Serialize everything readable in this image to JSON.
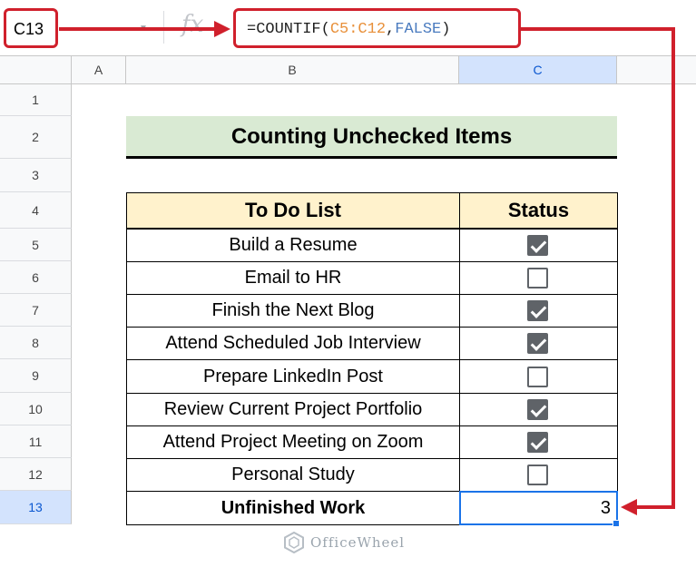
{
  "formula_bar": {
    "name_box": "C13",
    "fx": "fx",
    "formula": {
      "prefix": "=COUNTIF(",
      "range": "C5:C12",
      "comma": ",",
      "arg": "FALSE",
      "suffix": ")"
    }
  },
  "columns": [
    "A",
    "B",
    "C"
  ],
  "rows": [
    "1",
    "2",
    "3",
    "4",
    "5",
    "6",
    "7",
    "8",
    "9",
    "10",
    "11",
    "12",
    "13"
  ],
  "active_cell": {
    "column": "C",
    "row": "13"
  },
  "title": "Counting Unchecked Items",
  "table": {
    "headers": [
      "To Do List",
      "Status"
    ],
    "items": [
      {
        "task": "Build a Resume",
        "checked": true
      },
      {
        "task": "Email to HR",
        "checked": false
      },
      {
        "task": "Finish the Next Blog",
        "checked": true
      },
      {
        "task": "Attend Scheduled Job Interview",
        "checked": true
      },
      {
        "task": "Prepare LinkedIn Post",
        "checked": false
      },
      {
        "task": "Review Current Project Portfolio",
        "checked": true
      },
      {
        "task": "Attend Project Meeting on Zoom",
        "checked": true
      },
      {
        "task": "Personal Study",
        "checked": false
      }
    ],
    "summary": {
      "label": "Unfinished Work",
      "value": "3"
    }
  },
  "watermark": "OfficeWheel",
  "colors": {
    "highlight_red": "#d0202c",
    "title_bg": "#d9ead3",
    "header_bg": "#fff2cc",
    "selection_blue": "#1a73e8",
    "range_orange": "#e8903a",
    "arg_blue": "#4a7bbf"
  }
}
